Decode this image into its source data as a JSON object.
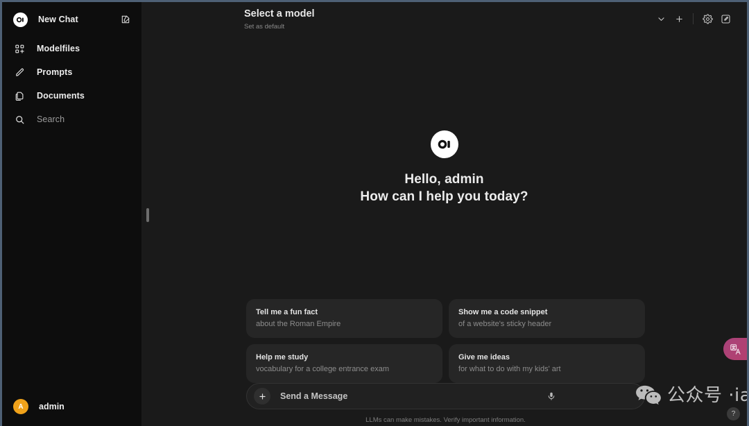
{
  "sidebar": {
    "new_chat": {
      "label": "New Chat",
      "logo_icon": "openwebui-logo-icon",
      "edit_icon": "pencil-square-icon"
    },
    "items": [
      {
        "label": "Modelfiles",
        "icon": "modelfiles-grid-icon"
      },
      {
        "label": "Prompts",
        "icon": "pencil-icon"
      },
      {
        "label": "Documents",
        "icon": "documents-copy-icon"
      }
    ],
    "search": {
      "label": "Search",
      "icon": "search-icon"
    },
    "user": {
      "name": "admin",
      "avatar_initial": "A",
      "avatar_color": "#f0a21a"
    }
  },
  "topbar": {
    "model_title": "Select a model",
    "set_default_label": "Set as default",
    "actions": [
      {
        "name": "chevron-down-icon"
      },
      {
        "name": "plus-icon"
      },
      {
        "name": "settings-gear-icon"
      },
      {
        "name": "edit-square-icon"
      }
    ]
  },
  "hero": {
    "logo_icon": "openwebui-logo-icon",
    "greeting_line1": "Hello, admin",
    "greeting_line2": "How can I help you today?"
  },
  "suggestions": [
    {
      "title": "Tell me a fun fact",
      "subtitle": "about the Roman Empire"
    },
    {
      "title": "Show me a code snippet",
      "subtitle": "of a website's sticky header"
    },
    {
      "title": "Help me study",
      "subtitle": "vocabulary for a college entrance exam"
    },
    {
      "title": "Give me ideas",
      "subtitle": "for what to do with my kids' art"
    }
  ],
  "composer": {
    "placeholder": "Send a Message",
    "value": "",
    "plus_icon": "plus-icon",
    "mic_icon": "microphone-icon",
    "disclaimer": "LLMs can make mistakes. Verify important information."
  },
  "watermark": {
    "logo_icon": "wechat-icon",
    "text": "公众号 ·iamtonybai"
  },
  "overlays": {
    "translate_widget": {
      "icon": "translate-icon",
      "label": "文A"
    },
    "help_button": {
      "label": "?"
    }
  },
  "colors": {
    "window_border": "#4e6075",
    "sidebar_bg": "#0d0d0d",
    "main_bg": "#1a1a1a",
    "card_bg": "#262626",
    "accent_avatar": "#f0a21a",
    "translate_accent": "#b4406f"
  }
}
